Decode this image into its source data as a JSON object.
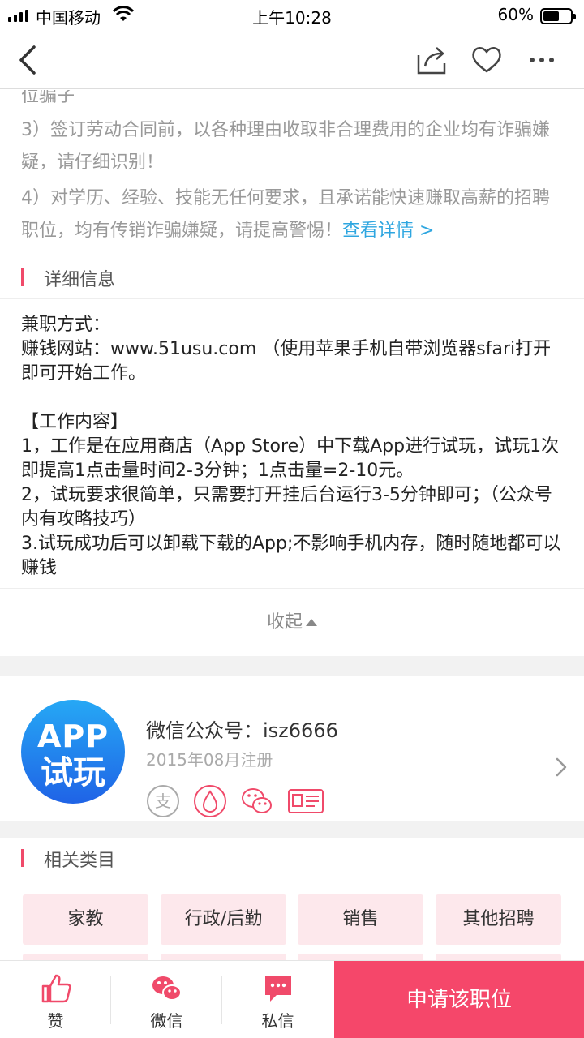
{
  "status": {
    "carrier": "中国移动",
    "time": "上午10:28",
    "battery": "60%",
    "battery_level": 0.6
  },
  "warnings": {
    "partial": "位骗子",
    "item3": "3）签订劳动合同前，以各种理由收取非合理费用的企业均有诈骗嫌疑，请仔细识别！",
    "item4": "4）对学历、经验、技能无任何要求，且承诺能快速赚取高薪的招聘职位，均有传销诈骗嫌疑，请提高警惕！",
    "link": "查看详情 >"
  },
  "detail_section": {
    "title": "详细信息",
    "lines": [
      "兼职方式：",
      "赚钱网站：www.51usu.com （使用苹果手机自带浏览器sfari打开 即可开始工作。",
      "",
      "【工作内容】",
      "1，工作是在应用商店（App Store）中下载App进行试玩，试玩1次即提高1点击量时间2-3分钟；1点击量=2-10元。",
      "2，试玩要求很简单，只需要打开挂后台运行3-5分钟即可；（公众号内有攻略技巧）",
      "3.试玩成功后可以卸载下载的App;不影响手机内存，随时随地都可以赚钱"
    ],
    "collapse": "收起"
  },
  "account": {
    "logo_line1": "APP",
    "logo_line2": "试玩",
    "name": "微信公众号：isz6666",
    "registered": "2015年08月注册",
    "badges": [
      "alipay-icon",
      "drop-icon",
      "wechat-icon",
      "id-card-icon"
    ]
  },
  "related": {
    "title": "相关类目",
    "categories": [
      "家教",
      "行政/后勤",
      "销售",
      "其他招聘"
    ]
  },
  "bottom": {
    "like": "赞",
    "wechat": "微信",
    "message": "私信",
    "apply": "申请该职位"
  },
  "colors": {
    "accent": "#f5476a",
    "link": "#2ea6e0",
    "tag_bg": "#fde8ec"
  }
}
